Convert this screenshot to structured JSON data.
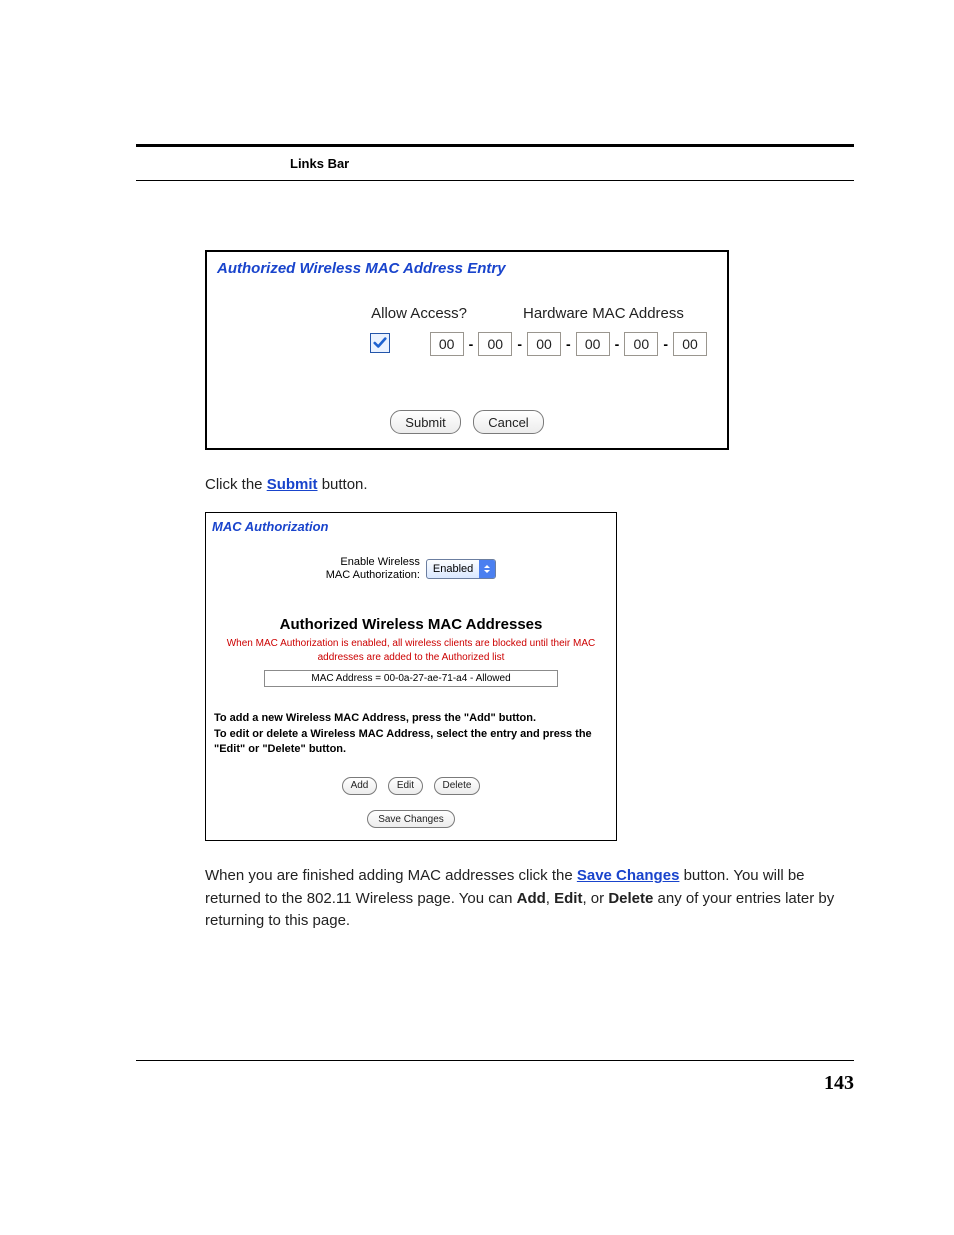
{
  "header": {
    "links_bar": "Links Bar"
  },
  "panel1": {
    "title": "Authorized Wireless MAC Address Entry",
    "allow_header": "Allow Access?",
    "mac_header": "Hardware MAC Address",
    "allow_checked": true,
    "octets": [
      "00",
      "00",
      "00",
      "00",
      "00",
      "00"
    ],
    "buttons": {
      "submit": "Submit",
      "cancel": "Cancel"
    }
  },
  "instr1": {
    "before": "Click the ",
    "link": "Submit",
    "after": " button."
  },
  "panel2": {
    "title": "MAC Authorization",
    "enable_label_l1": "Enable Wireless",
    "enable_label_l2": "MAC Authorization:",
    "enable_value": "Enabled",
    "section_heading": "Authorized Wireless MAC Addresses",
    "red_note": "When MAC Authorization is enabled, all wireless clients are blocked until their MAC addresses are added to the Authorized list",
    "list_entry": "MAC Address = 00-0a-27-ae-71-a4 - Allowed",
    "cmds_l1": "To add a new Wireless MAC Address, press the \"Add\" button.",
    "cmds_l2": "To edit or delete a Wireless MAC Address, select the entry and press the \"Edit\" or \"Delete\" button.",
    "buttons": {
      "add": "Add",
      "edit": "Edit",
      "delete": "Delete",
      "save": "Save Changes"
    }
  },
  "instr2": {
    "t1": "When you are finished adding MAC addresses click the ",
    "link": "Save Changes",
    "t2": " button. You will be returned to the 802.11 Wireless page. You can ",
    "b1": "Add",
    "t3": ", ",
    "b2": "Edit",
    "t4": ", or ",
    "b3": "Delete",
    "t5": " any of your entries later by returning to this page."
  },
  "page_number": "143"
}
